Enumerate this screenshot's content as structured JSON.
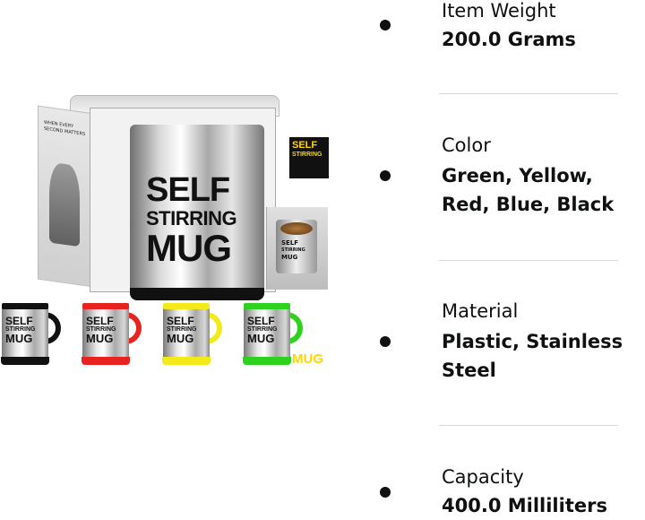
{
  "product_image": {
    "box_text": {
      "line1": "SELF",
      "line2": "STIRRING",
      "line3": "MUG"
    },
    "box_logo": {
      "line1": "SELF",
      "line2": "STIRRING",
      "line3": "MUG"
    },
    "box_side_text": "WHEN EVERY SECOND MATTERS",
    "inset_text": {
      "line1": "SELF",
      "line2": "STIRRING",
      "line3": "MUG"
    },
    "mugs": [
      {
        "color_name": "Black",
        "accent": "#111111",
        "line1": "SELF",
        "line2": "STIRRING",
        "line3": "MUG"
      },
      {
        "color_name": "Red",
        "accent": "#e8221f",
        "line1": "SELF",
        "line2": "STIRRING",
        "line3": "MUG"
      },
      {
        "color_name": "Yellow",
        "accent": "#f2ea1b",
        "line1": "SELF",
        "line2": "STIRRING",
        "line3": "MUG"
      },
      {
        "color_name": "Green",
        "accent": "#2fd11f",
        "line1": "SELF",
        "line2": "STIRRING",
        "line3": "MUG"
      }
    ]
  },
  "specs": [
    {
      "label": "Item Weight",
      "value": "200.0 Grams"
    },
    {
      "label": "Color",
      "value": "Green, Yellow, Red, Blue, Black"
    },
    {
      "label": "Material",
      "value": "Plastic, Stainless Steel"
    },
    {
      "label": "Capacity",
      "value": "400.0 Milliliters"
    }
  ],
  "colors": {
    "text": "#0f1111",
    "divider": "#d5d9d9",
    "logo_yellow": "#ffd600"
  }
}
